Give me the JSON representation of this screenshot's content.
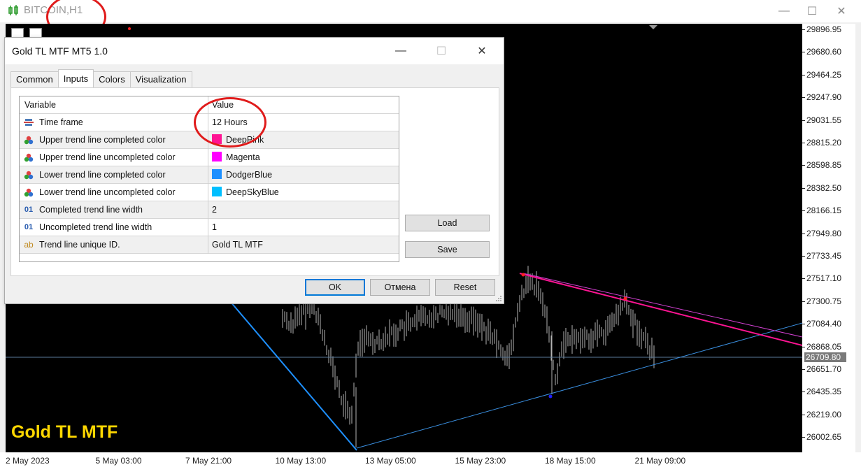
{
  "window": {
    "title": "BITCOIN,H1",
    "controls": {
      "minimize": "—",
      "maximize": "☐",
      "close": "✕"
    }
  },
  "chart": {
    "label": "Gold TL MTF",
    "current_price": "26709.80",
    "price_ticks": [
      "29896.95",
      "29680.60",
      "29464.25",
      "29247.90",
      "29031.55",
      "28815.20",
      "28598.85",
      "28382.50",
      "28166.15",
      "27949.80",
      "27733.45",
      "27517.10",
      "27300.75",
      "27084.40",
      "26868.05",
      "26651.70",
      "26435.35",
      "26219.00",
      "26002.65"
    ],
    "time_ticks": [
      "2 May 2023",
      "5 May 03:00",
      "7 May 21:00",
      "10 May 13:00",
      "13 May 05:00",
      "15 May 23:00",
      "18 May 15:00",
      "21 May 09:00"
    ],
    "colors": {
      "background": "#000000",
      "bars": "#b4b4b4",
      "upper_line": "#ff1493",
      "upper_thin": "#ff00ff",
      "lower_line": "#1e90ff"
    }
  },
  "dialog": {
    "title": "Gold TL MTF MT5 1.0",
    "controls": {
      "minimize": "—",
      "maximize": "☐",
      "close": "✕"
    },
    "tabs": [
      "Common",
      "Inputs",
      "Colors",
      "Visualization"
    ],
    "active_tab": "Inputs",
    "grid": {
      "headers": {
        "variable": "Variable",
        "value": "Value"
      },
      "rows": [
        {
          "icon": "timeframe-icon",
          "variable": "Time frame",
          "value": "12 Hours",
          "color": ""
        },
        {
          "icon": "color-icon",
          "variable": "Upper trend line completed color",
          "value": "DeepPink",
          "color": "#ff1493"
        },
        {
          "icon": "color-icon",
          "variable": "Upper trend line uncompleted color",
          "value": "Magenta",
          "color": "#ff00ff"
        },
        {
          "icon": "color-icon",
          "variable": "Lower trend line completed color",
          "value": "DodgerBlue",
          "color": "#1e90ff"
        },
        {
          "icon": "color-icon",
          "variable": "Lower trend line uncompleted color",
          "value": "DeepSkyBlue",
          "color": "#00bfff"
        },
        {
          "icon": "integer-icon",
          "variable": "Completed trend line width",
          "value": "2",
          "color": ""
        },
        {
          "icon": "integer-icon",
          "variable": "Uncompleted trend line width",
          "value": "1",
          "color": ""
        },
        {
          "icon": "string-icon",
          "variable": "Trend line unique ID.",
          "value": "Gold TL MTF",
          "color": ""
        }
      ]
    },
    "buttons": {
      "load": "Load",
      "save": "Save",
      "ok": "OK",
      "cancel": "Отмена",
      "reset": "Reset"
    }
  }
}
